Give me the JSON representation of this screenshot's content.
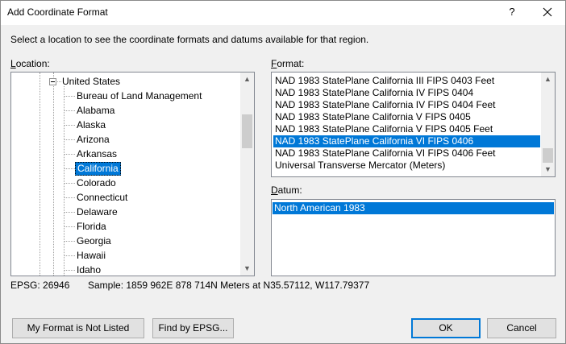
{
  "window": {
    "title": "Add Coordinate Format",
    "help_label": "?"
  },
  "instruction": "Select a location to see the coordinate formats and datums available for that region.",
  "location": {
    "label_prefix": "",
    "label_hotkey": "L",
    "label_rest": "ocation:",
    "tree": {
      "parent": "United States",
      "children": [
        "Bureau of Land Management",
        "Alabama",
        "Alaska",
        "Arizona",
        "Arkansas",
        "California",
        "Colorado",
        "Connecticut",
        "Delaware",
        "Florida",
        "Georgia",
        "Hawaii",
        "Idaho"
      ],
      "selected": "California"
    }
  },
  "format": {
    "label_hotkey": "F",
    "label_rest": "ormat:",
    "items": [
      "NAD 1983 StatePlane California III FIPS 0403 Feet",
      "NAD 1983 StatePlane California IV FIPS 0404",
      "NAD 1983 StatePlane California IV FIPS 0404 Feet",
      "NAD 1983 StatePlane California V FIPS 0405",
      "NAD 1983 StatePlane California V FIPS 0405 Feet",
      "NAD 1983 StatePlane California VI FIPS 0406",
      "NAD 1983 StatePlane California VI FIPS 0406 Feet",
      "Universal Transverse Mercator (Meters)"
    ],
    "selected": "NAD 1983 StatePlane California VI FIPS 0406"
  },
  "datum": {
    "label_hotkey": "D",
    "label_rest": "atum:",
    "items": [
      "North American 1983"
    ],
    "selected": "North American 1983"
  },
  "info": {
    "epsg": "EPSG: 26946",
    "sample": "Sample: 1859 962E  878 714N Meters at N35.57112, W117.79377"
  },
  "buttons": {
    "not_listed": "My Format is Not Listed",
    "find_epsg": "Find by EPSG...",
    "ok": "OK",
    "cancel": "Cancel"
  },
  "colors": {
    "selection": "#0078d7",
    "default_button_border": "#0078d7"
  },
  "icons": {
    "close": "close-icon",
    "scroll_up": "scroll-up-arrow-icon",
    "scroll_down": "scroll-down-arrow-icon",
    "collapse": "tree-collapse-icon"
  }
}
